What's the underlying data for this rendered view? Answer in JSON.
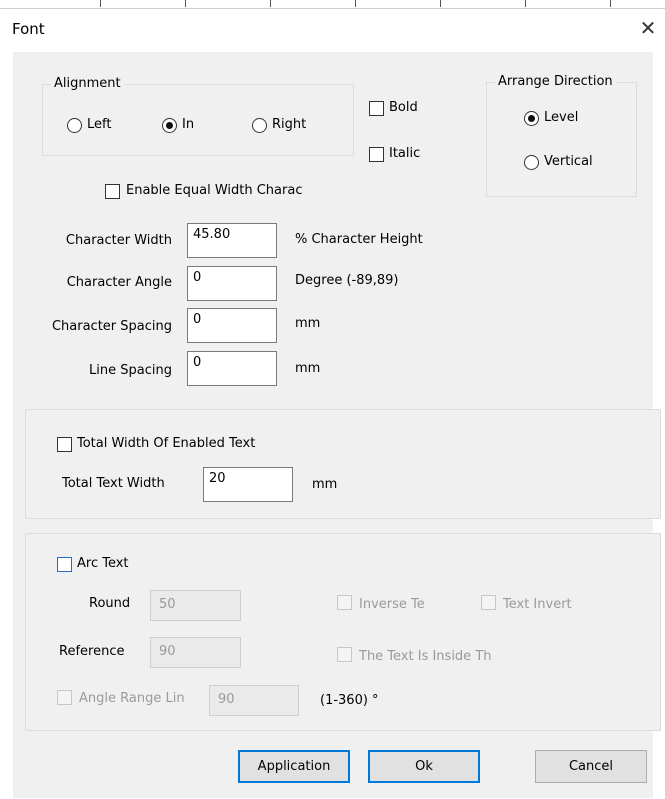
{
  "dialog": {
    "title": "Font"
  },
  "alignment": {
    "legend": "Alignment",
    "options": [
      "Left",
      "In",
      "Right"
    ],
    "selected": "In"
  },
  "style": {
    "bold": "Bold",
    "italic": "Italic"
  },
  "arrange": {
    "legend": "Arrange Direction",
    "options": [
      "Level",
      "Vertical"
    ],
    "selected": "Level"
  },
  "equal_width": {
    "label": "Enable Equal Width Charac"
  },
  "params": {
    "char_width": {
      "label": "Character Width",
      "value": "45.80",
      "unit": "% Character Height"
    },
    "char_angle": {
      "label": "Character Angle",
      "value": "0",
      "unit": "Degree (-89,89)"
    },
    "char_spacing": {
      "label": "Character Spacing",
      "value": "0",
      "unit": "mm"
    },
    "line_spacing": {
      "label": "Line Spacing",
      "value": "0",
      "unit": "mm"
    }
  },
  "total": {
    "check_label": "Total Width Of Enabled Text",
    "width_label": "Total Text Width",
    "width_value": "20",
    "unit": "mm"
  },
  "arc": {
    "check_label": "Arc Text",
    "round_label": "Round",
    "round_value": "50",
    "reference_label": "Reference",
    "reference_value": "90",
    "inverse_label": "Inverse Te",
    "text_invert_label": "Text Invert",
    "inside_label": "The Text Is Inside Th",
    "angle_label": "Angle Range Lin",
    "angle_value": "90",
    "angle_unit": "(1-360) °"
  },
  "buttons": {
    "apply": "Application",
    "ok": "Ok",
    "cancel": "Cancel"
  }
}
